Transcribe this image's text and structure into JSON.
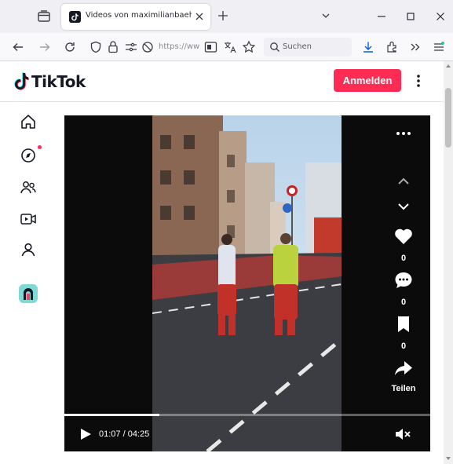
{
  "browser": {
    "tab_title": "Videos von maximilianbaehring",
    "url_text": "https://ww",
    "search_placeholder": "Suchen"
  },
  "header": {
    "logo_text": "TikTok",
    "login_label": "Anmelden"
  },
  "sidebar": {
    "items": [
      "home-icon",
      "explore-icon",
      "following-icon",
      "live-icon",
      "profile-icon",
      "avatar"
    ]
  },
  "video": {
    "like_count": "0",
    "comment_count": "0",
    "save_count": "0",
    "share_label": "Teilen",
    "time": "01:07 / 04:25",
    "progress": 0.26
  },
  "colors": {
    "brand": "#fe2c55",
    "text": "#161823"
  }
}
